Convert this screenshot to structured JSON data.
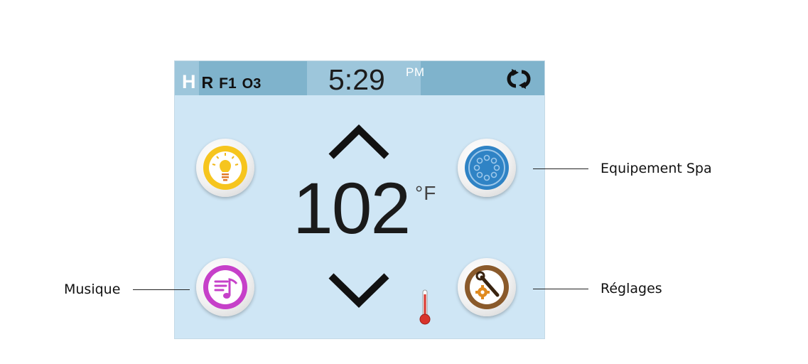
{
  "status_bar": {
    "indicators": [
      "H",
      "R",
      "F1",
      "O3"
    ],
    "time": "5:29",
    "ampm": "PM",
    "refresh_icon": "refresh-icon"
  },
  "temperature": {
    "value": "102",
    "unit": "°F"
  },
  "buttons": {
    "light": {
      "icon": "lightbulb-icon",
      "color": "#f4c21f"
    },
    "spa_equipment": {
      "icon": "spa-jets-icon",
      "color": "#2f83c5"
    },
    "music": {
      "icon": "music-icon",
      "color": "#c640c9"
    },
    "settings": {
      "icon": "tools-gear-icon",
      "color": "#8a5a2b"
    }
  },
  "callouts": {
    "spa_equipment": "Equipement Spa",
    "music": "Musique",
    "settings": "Réglages"
  },
  "colors": {
    "panel_background": "#cfe6f5",
    "status_bar": "#7fb3cc"
  }
}
